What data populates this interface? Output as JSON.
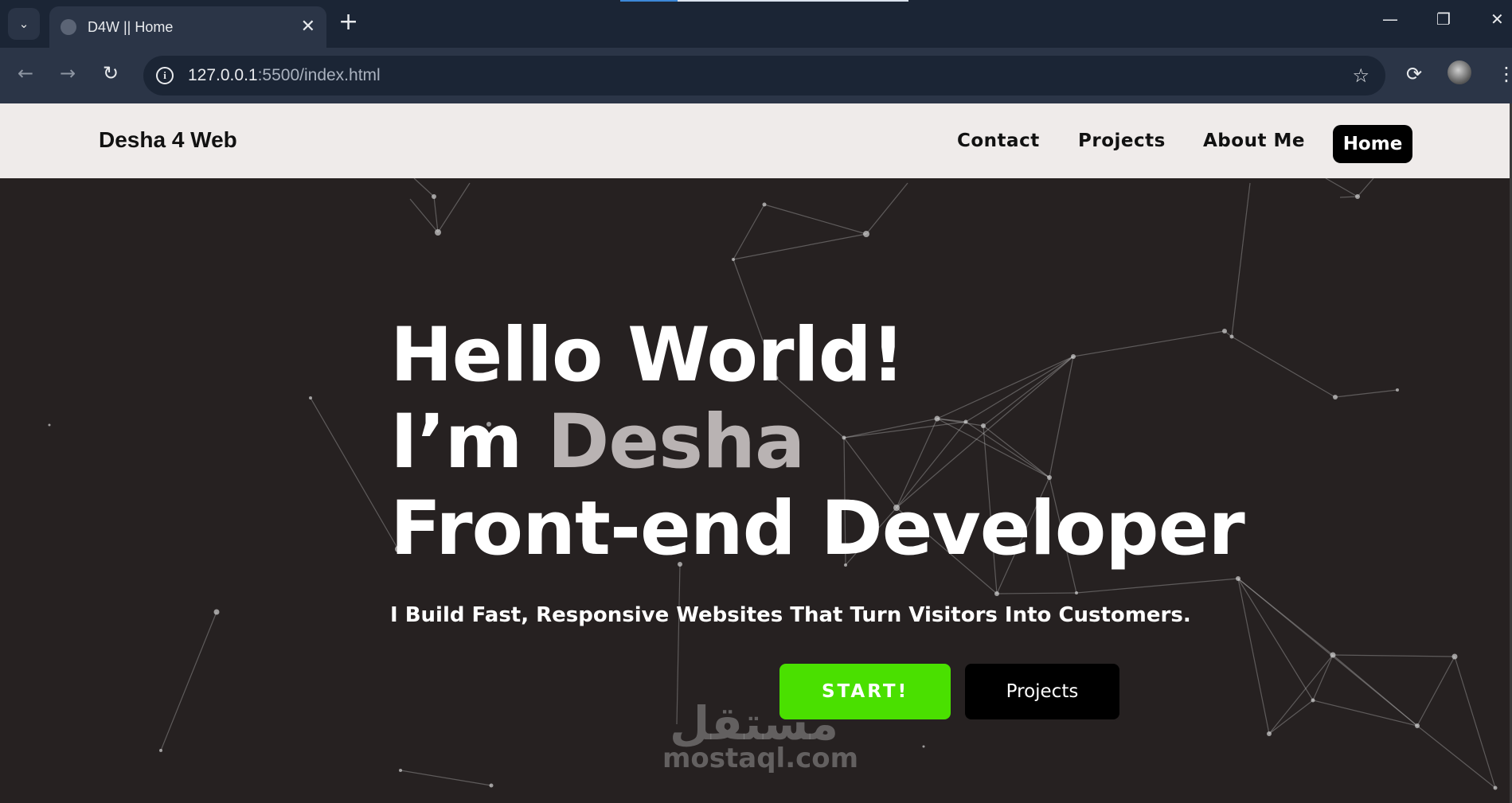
{
  "browser": {
    "tab_title": "D4W || Home",
    "tab_list_icon": "chevron-down-icon",
    "new_tab_label": "+",
    "url_host": "127.0.0.1",
    "url_path": ":5500/index.html",
    "window_controls": {
      "minimize": "—",
      "restore": "❐",
      "close": "✕"
    },
    "nav": {
      "back": "←",
      "forward": "→",
      "reload": "↻"
    },
    "star": "☆",
    "menu": "⋮"
  },
  "site": {
    "brand": "Desha 4 Web",
    "nav": {
      "contact": "Contact",
      "projects": "Projects",
      "about": "About Me",
      "home": "Home"
    },
    "hero": {
      "line1": "Hello World!",
      "line2_prefix": "I’m ",
      "line2_accent": "Desha",
      "line3": "Front-end Developer",
      "tagline": "I Build Fast, Responsive Websites That Turn Visitors Into Customers.",
      "start_button": "START!",
      "projects_button": "Projects"
    },
    "colors": {
      "accent_green": "#4ae000",
      "background": "#262121",
      "navbar": "#efebea"
    }
  },
  "watermark": {
    "arabic": "مستقل",
    "latin": "mostaql.com"
  }
}
